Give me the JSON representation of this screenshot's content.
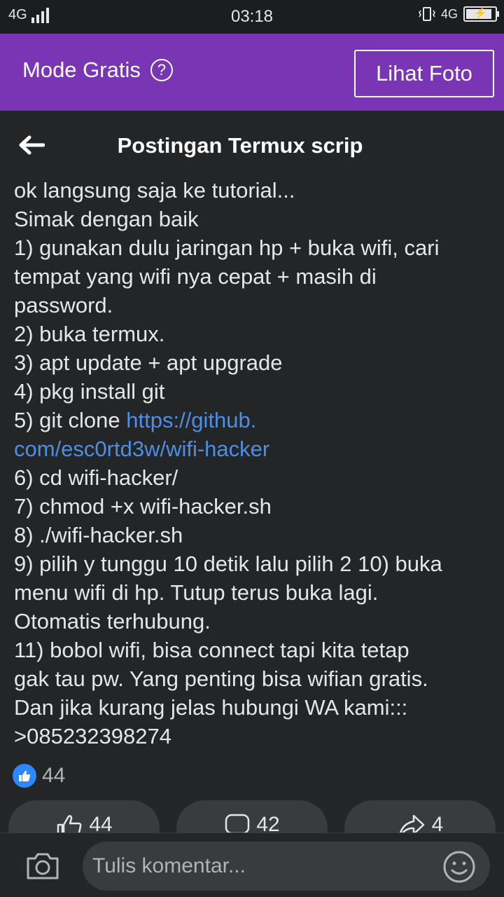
{
  "status_bar": {
    "network_left": "4G",
    "time": "03:18",
    "network_right": "4G"
  },
  "banner": {
    "mode_label": "Mode Gratis",
    "help_symbol": "?",
    "view_photo_label": "Lihat Foto"
  },
  "header": {
    "title": "Postingan Termux scrip"
  },
  "post": {
    "lines": [
      "ok langsung saja ke tutorial...",
      "Simak dengan baik",
      "1) gunakan dulu jaringan hp + buka wifi, cari",
      "tempat yang wifi nya cepat + masih di",
      "password.",
      "2) buka termux.",
      "3) apt update + apt upgrade",
      "4) pkg install git",
      "5) git clone ",
      "6) cd wifi-hacker/",
      "7) chmod +x wifi-hacker.sh",
      "8) ./wifi-hacker.sh",
      "9) pilih y tunggu 10 detik lalu pilih 2 10) buka",
      "menu wifi di hp. Tutup terus buka lagi.",
      "Otomatis terhubung.",
      "11) bobol wifi, bisa connect tapi kita tetap",
      "gak tau pw. Yang penting bisa wifian gratis.",
      "Dan jika kurang jelas hubungi WA kami:::",
      ">085232398274"
    ],
    "link_line1": "https://github.",
    "link_line2": "com/esc0rtd3w/wifi-hacker"
  },
  "reactions": {
    "like_count": "44"
  },
  "actions": {
    "like_count": "44",
    "comment_count": "42",
    "share_count": "4"
  },
  "comment_bar": {
    "placeholder": "Tulis komentar..."
  },
  "icons": {
    "back": "arrow-left-icon",
    "camera": "camera-icon",
    "emoji": "smiley-icon",
    "like": "thumbs-up-icon",
    "comment": "comment-bubble-icon",
    "share": "share-arrow-icon"
  },
  "colors": {
    "banner": "#7a35b5",
    "link": "#4b8fe6",
    "like_badge": "#2d88ff",
    "background": "#242526"
  }
}
